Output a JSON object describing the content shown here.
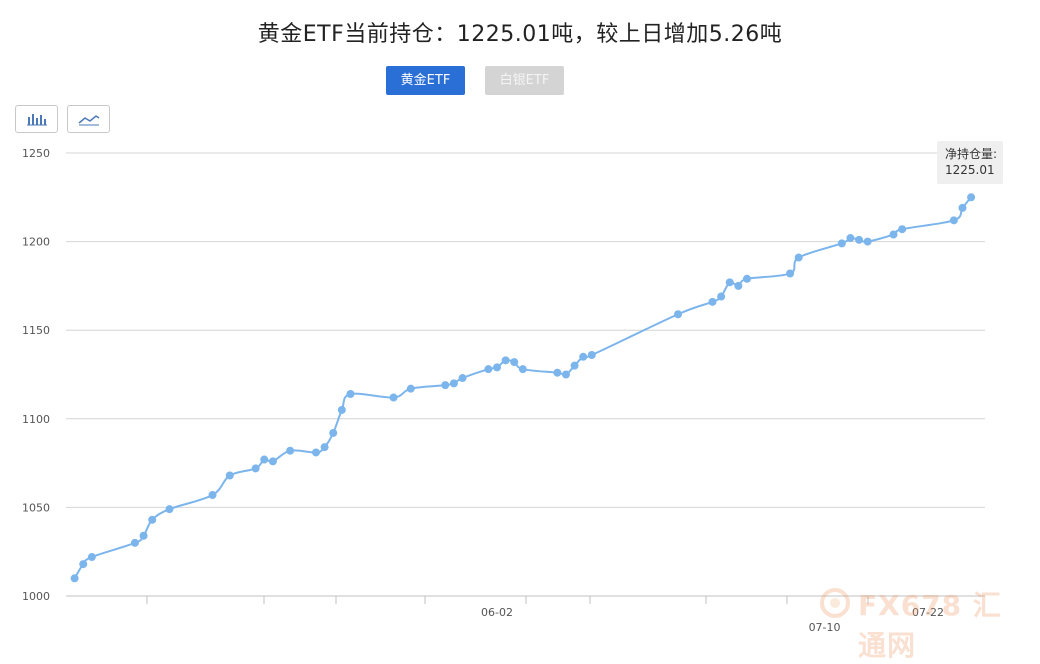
{
  "title": "黄金ETF当前持仓：1225.01吨，较上日增加5.26吨",
  "tabs": {
    "gold": "黄金ETF",
    "silver": "白银ETF"
  },
  "chart_type_buttons": [
    "bar-chart-icon",
    "line-chart-icon"
  ],
  "tooltip": {
    "label": "净持仓量:",
    "value": "1225.01"
  },
  "watermark": {
    "text": "FX678 汇通网"
  },
  "colors": {
    "series": "#7cb5ec",
    "active_tab": "#2a6fd6",
    "inactive_tab": "#d4d4d4"
  },
  "chart_data": {
    "type": "line",
    "title": "",
    "xlabel": "",
    "ylabel": "",
    "ylim": [
      1000,
      1250
    ],
    "yticks": [
      1000,
      1050,
      1100,
      1150,
      1200,
      1250
    ],
    "xtick_labels": [
      {
        "label": "06-02",
        "i": 50
      },
      {
        "label": "07-10",
        "i": 88
      },
      {
        "label": "07-22",
        "i": 100
      }
    ],
    "grid": true,
    "legend": "none",
    "series": [
      {
        "values": [
          1010,
          1018,
          1022,
          1030,
          1034,
          1043,
          1049,
          1057,
          1068,
          1072,
          1077,
          1076,
          1082,
          1081,
          1084,
          1092,
          1105,
          1114,
          1112,
          1117,
          1119,
          1120,
          1123,
          1128,
          1129,
          1133,
          1132,
          1128,
          1126,
          1125,
          1130,
          1135,
          1136,
          1159,
          1166,
          1169,
          1177,
          1175,
          1179,
          1182,
          1191,
          1199,
          1202,
          1201,
          1200,
          1204,
          1207,
          1212,
          1219,
          1225.01
        ],
        "idx": [
          1,
          2,
          3,
          8,
          9,
          10,
          12,
          17,
          19,
          22,
          23,
          24,
          26,
          29,
          30,
          31,
          32,
          33,
          38,
          40,
          44,
          45,
          46,
          49,
          50,
          51,
          52,
          53,
          57,
          58,
          59,
          60,
          61,
          71,
          75,
          76,
          77,
          78,
          79,
          84,
          85,
          90,
          91,
          92,
          93,
          96,
          97,
          103,
          104,
          105
        ]
      }
    ]
  }
}
